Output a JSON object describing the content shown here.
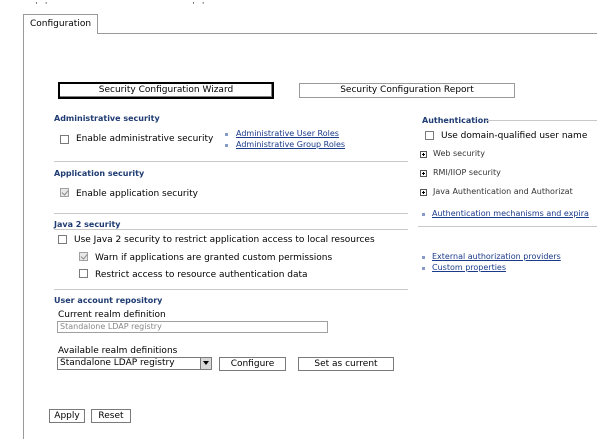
{
  "tabs": [
    {
      "label": "Configuration"
    }
  ],
  "wizard_button": "Security Configuration Wizard",
  "report_button": "Security Configuration Report",
  "admin": {
    "title": "Administrative security",
    "enable_label": "Enable administrative security",
    "enable_checked": false,
    "links": [
      "Administrative User Roles",
      "Administrative Group Roles"
    ]
  },
  "app": {
    "title": "Application security",
    "enable_label": "Enable application security",
    "enable_checked": true
  },
  "java2": {
    "title": "Java 2 security",
    "use_label": "Use Java 2 security to restrict application access to local resources",
    "use_checked": false,
    "warn_label": "Warn if applications are granted custom permissions",
    "warn_checked": true,
    "restrict_label": "Restrict access to resource authentication data",
    "restrict_checked": false
  },
  "repo": {
    "title": "User account repository",
    "current_label": "Current realm definition",
    "current_value": "Standalone LDAP registry",
    "available_label": "Available realm definitions",
    "available_value": "Standalone LDAP registry",
    "configure_button": "Configure",
    "set_current_button": "Set as current"
  },
  "auth": {
    "title": "Authentication",
    "domain_label": "Use domain-qualified user name",
    "domain_checked": false,
    "tree": [
      "Web security",
      "RMI/IIOP security",
      "Java Authentication and Authorizat"
    ],
    "mechanisms_link": "Authentication mechanisms and expira",
    "links": [
      "External authorization providers",
      "Custom properties"
    ]
  },
  "footer": {
    "apply": "Apply",
    "reset": "Reset"
  }
}
